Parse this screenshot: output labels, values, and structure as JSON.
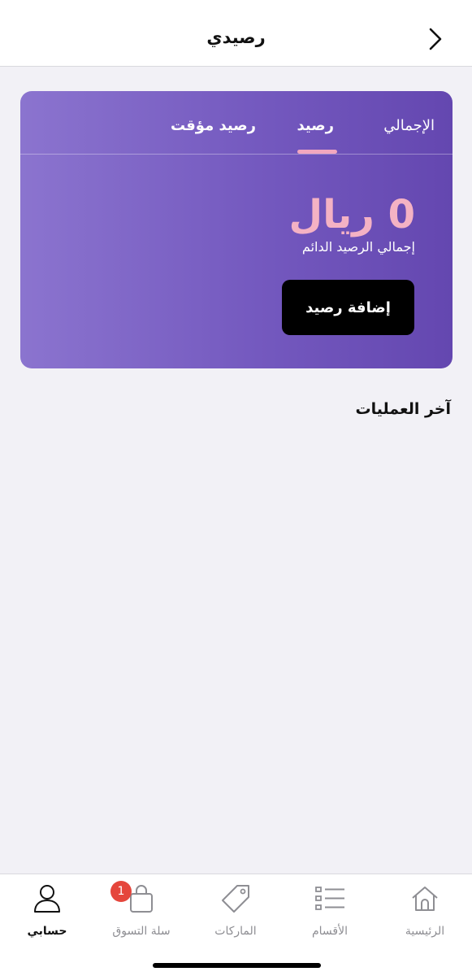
{
  "header": {
    "title": "رصيدي"
  },
  "card": {
    "tabs": [
      {
        "label": "الإجمالي"
      },
      {
        "label": "رصيد"
      },
      {
        "label": "رصيد مؤقت"
      }
    ],
    "amount": "0 ريال",
    "amount_label": "إجمالي الرصيد الدائم",
    "add_button_label": "إضافة رصيد"
  },
  "transactions": {
    "title": "آخر العمليات"
  },
  "bottom_nav": {
    "items": [
      {
        "label": "الرئيسية",
        "icon": "home-icon"
      },
      {
        "label": "الأقسام",
        "icon": "list-icon"
      },
      {
        "label": "الماركات",
        "icon": "tag-icon"
      },
      {
        "label": "سلة التسوق",
        "icon": "bag-icon",
        "badge": "1"
      },
      {
        "label": "حسابي",
        "icon": "user-icon",
        "active": true
      }
    ]
  },
  "colors": {
    "accent_pink": "#f4b2c4",
    "card_purple": "#7459bf",
    "badge_red": "#e5463c"
  }
}
